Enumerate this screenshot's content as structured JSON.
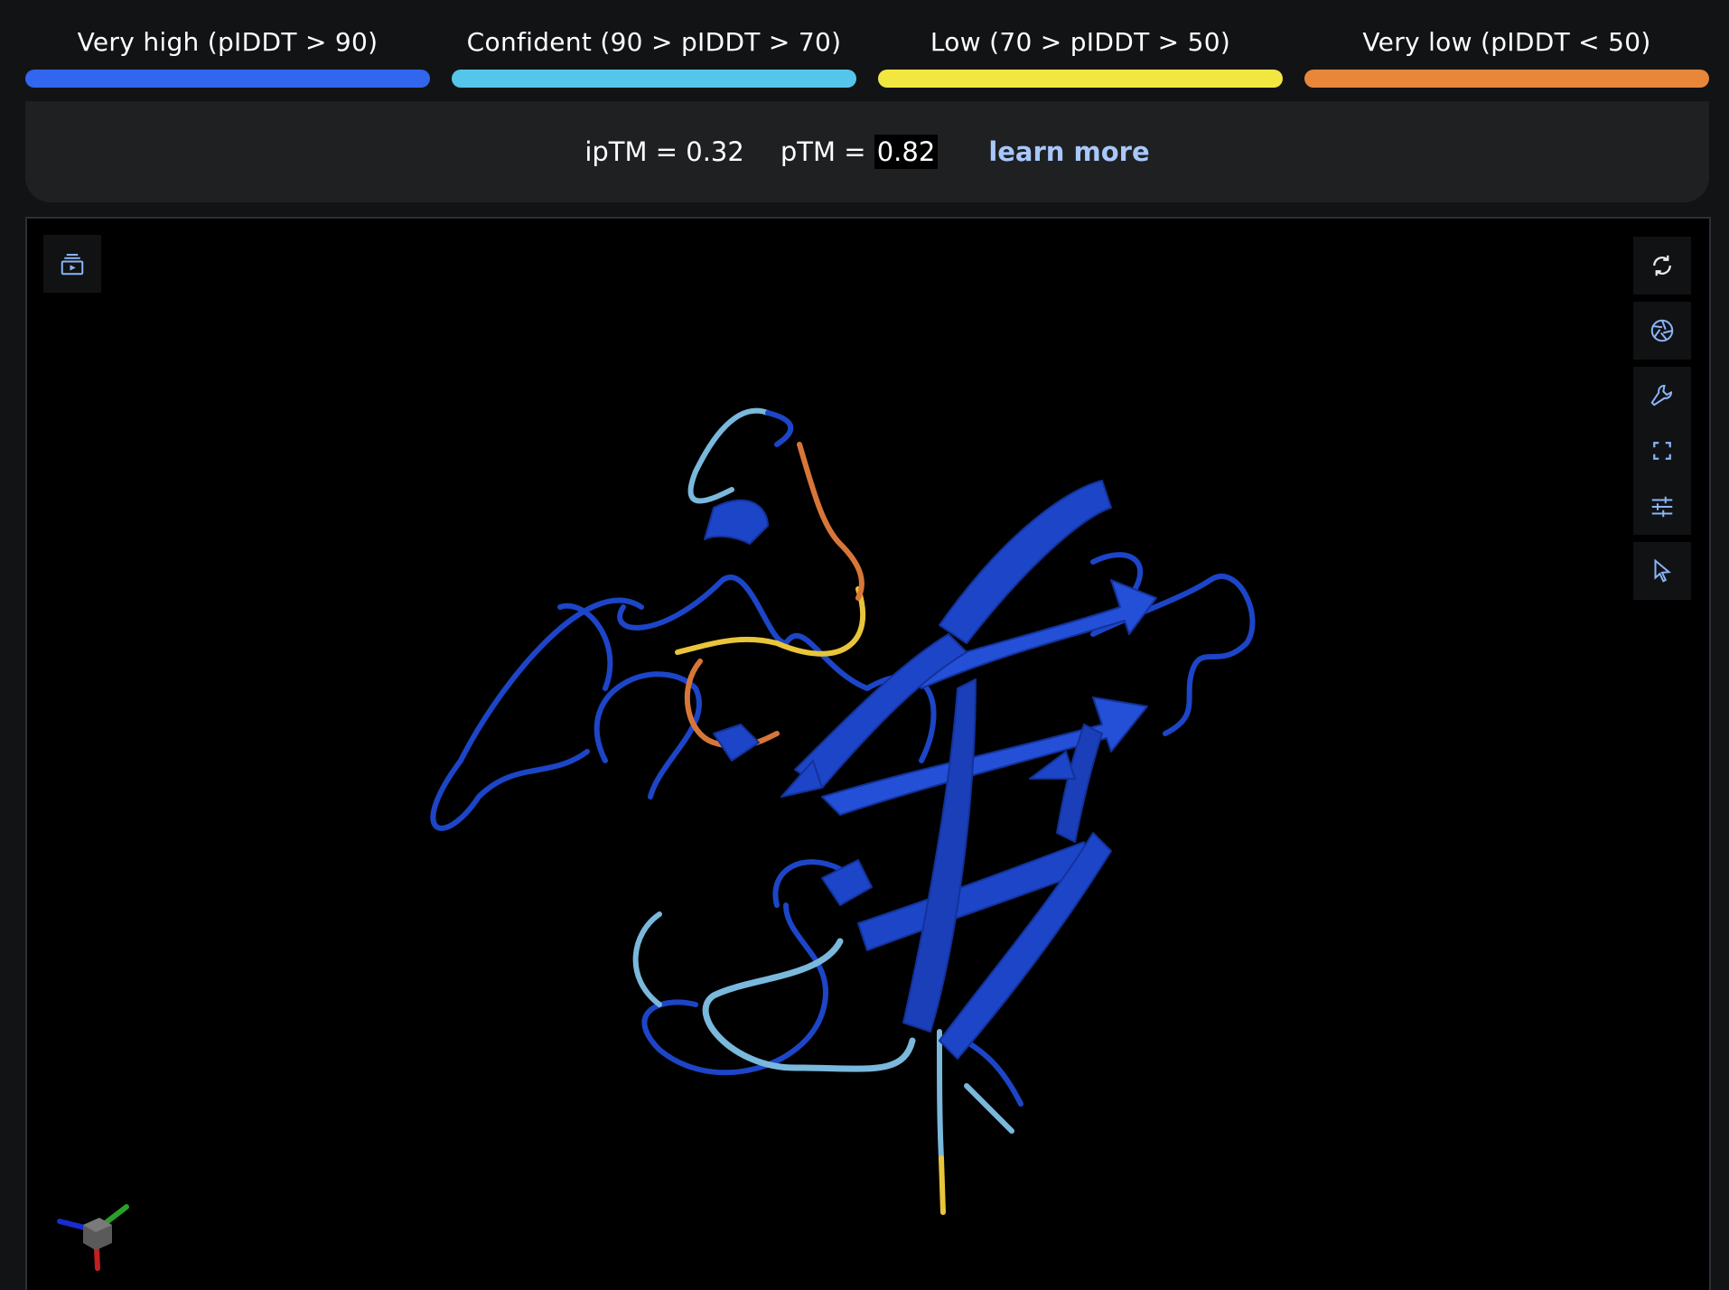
{
  "legend": [
    {
      "label": "Very high (pIDDT > 90)",
      "color": "#3366ee"
    },
    {
      "label": "Confident (90 > pIDDT > 70)",
      "color": "#55c6ea"
    },
    {
      "label": "Low (70 > pIDDT > 50)",
      "color": "#f2e641"
    },
    {
      "label": "Very low (pIDDT < 50)",
      "color": "#e8873a"
    }
  ],
  "metrics": {
    "iptm": "ipTM = 0.32",
    "ptm_label": "pTM = ",
    "ptm_value": "0.82",
    "learn_more": "learn more"
  },
  "toolbar": {
    "left": "play-stack-icon",
    "right": [
      "rotate-icon",
      "camera-aperture-icon",
      "wrench-icon",
      "fullscreen-icon",
      "sliders-icon",
      "cursor-icon"
    ]
  },
  "colors": {
    "strand": "#1d45c8",
    "strand_dark": "#13329a",
    "very_high": "#1d45c8",
    "confident": "#7ab8dc",
    "low": "#e8c53a",
    "very_low": "#d8763a"
  }
}
